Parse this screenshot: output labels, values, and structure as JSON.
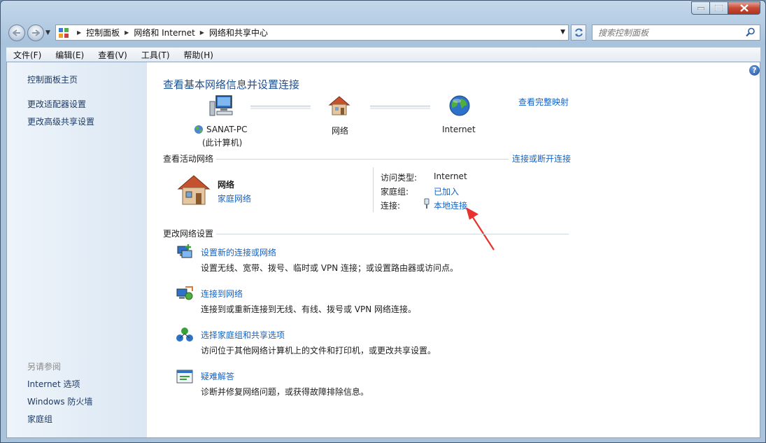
{
  "window": {
    "search_placeholder": "搜索控制面板"
  },
  "breadcrumb": [
    "控制面板",
    "网络和 Internet",
    "网络和共享中心"
  ],
  "menu": [
    "文件(F)",
    "编辑(E)",
    "查看(V)",
    "工具(T)",
    "帮助(H)"
  ],
  "sidebar": {
    "top_items": [
      "控制面板主页",
      "更改适配器设置",
      "更改高级共享设置"
    ],
    "see_also_label": "另请参阅",
    "see_also_items": [
      "Internet 选项",
      "Windows 防火墙",
      "家庭组"
    ]
  },
  "main": {
    "title": "查看基本网络信息并设置连接",
    "full_map_link": "查看完整映射",
    "map": {
      "computer_name": "SANAT-PC",
      "computer_sub": "(此计算机)",
      "network_label": "网络",
      "internet_label": "Internet"
    },
    "active": {
      "header": "查看活动网络",
      "connect_link": "连接或断开连接",
      "network_name": "网络",
      "network_type": "家庭网络",
      "access_label": "访问类型:",
      "access_value": "Internet",
      "homegroup_label": "家庭组:",
      "homegroup_value": "已加入",
      "connection_label": "连接:",
      "connection_value": "本地连接"
    },
    "settings_header": "更改网络设置",
    "tasks": [
      {
        "title": "设置新的连接或网络",
        "desc": "设置无线、宽带、拨号、临时或 VPN 连接；或设置路由器或访问点。",
        "icon": "new-connection-icon"
      },
      {
        "title": "连接到网络",
        "desc": "连接到或重新连接到无线、有线、拨号或 VPN 网络连接。",
        "icon": "connect-network-icon"
      },
      {
        "title": "选择家庭组和共享选项",
        "desc": "访问位于其他网络计算机上的文件和打印机，或更改共享设置。",
        "icon": "homegroup-icon"
      },
      {
        "title": "疑难解答",
        "desc": "诊断并修复网络问题，或获得故障排除信息。",
        "icon": "troubleshoot-icon"
      }
    ]
  },
  "colors": {
    "link": "#1563c6",
    "title": "#1e4f8f",
    "annotation_arrow": "#e8322e"
  }
}
